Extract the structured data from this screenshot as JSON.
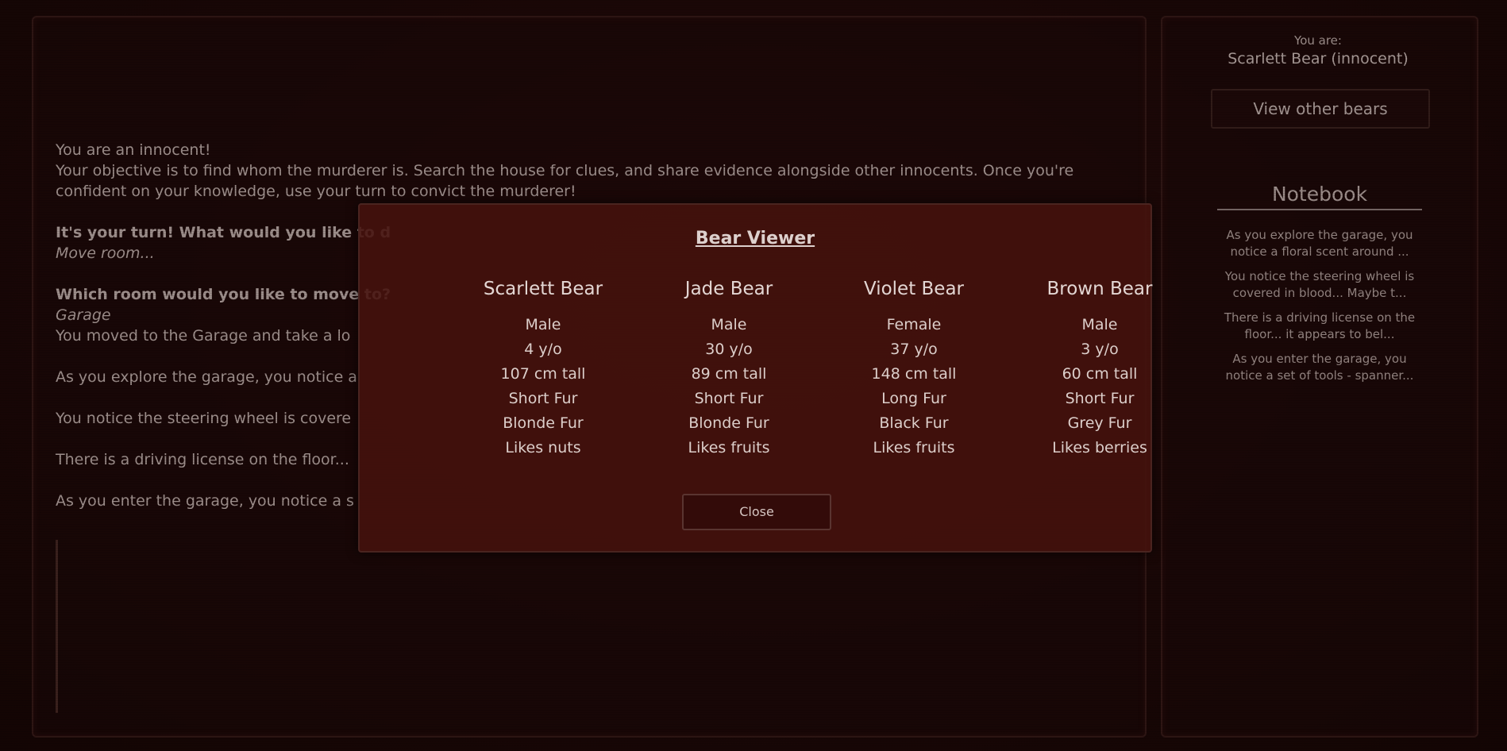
{
  "log": {
    "line1": "You are an innocent!",
    "line2": "Your objective is to find whom the murderer is. Search the house for clues, and share evidence alongside other innocents. Once you're confident on your knowledge, use your turn to convict the murderer!",
    "turn_prompt": "It's your turn! What would you like to d",
    "turn_choice": "Move room...",
    "room_prompt": "Which room would you like to move to?",
    "room_choice": "Garage",
    "moved": "You moved to the Garage and take a lo",
    "clue1": "As you explore the garage, you notice a",
    "clue2": "You notice the steering wheel is covere",
    "clue3": "There is a driving license on the floor...",
    "clue4": "As you enter the garage, you notice a s"
  },
  "sidebar": {
    "you_label": "You are:",
    "you_name": "Scarlett Bear (innocent)",
    "view_button": "View other bears",
    "notebook_title": "Notebook",
    "notes": [
      "As you explore the garage, you notice a floral scent around ...",
      "You notice the steering wheel is covered in blood... Maybe t...",
      "There is a driving license on the floor... it appears to bel...",
      "As you enter the garage, you notice a set of tools - spanner..."
    ]
  },
  "modal": {
    "title": "Bear Viewer",
    "close_label": "Close",
    "bears": [
      {
        "name": "Scarlett Bear",
        "traits": [
          "Male",
          "4 y/o",
          "107 cm tall",
          "Short Fur",
          "Blonde Fur",
          "Likes nuts"
        ]
      },
      {
        "name": "Jade Bear",
        "traits": [
          "Male",
          "30 y/o",
          "89 cm tall",
          "Short Fur",
          "Blonde Fur",
          "Likes fruits"
        ]
      },
      {
        "name": "Violet Bear",
        "traits": [
          "Female",
          "37 y/o",
          "148 cm tall",
          "Long Fur",
          "Black Fur",
          "Likes fruits"
        ]
      },
      {
        "name": "Brown Bear",
        "traits": [
          "Male",
          "3 y/o",
          "60 cm tall",
          "Short Fur",
          "Grey Fur",
          "Likes berries"
        ]
      }
    ]
  }
}
